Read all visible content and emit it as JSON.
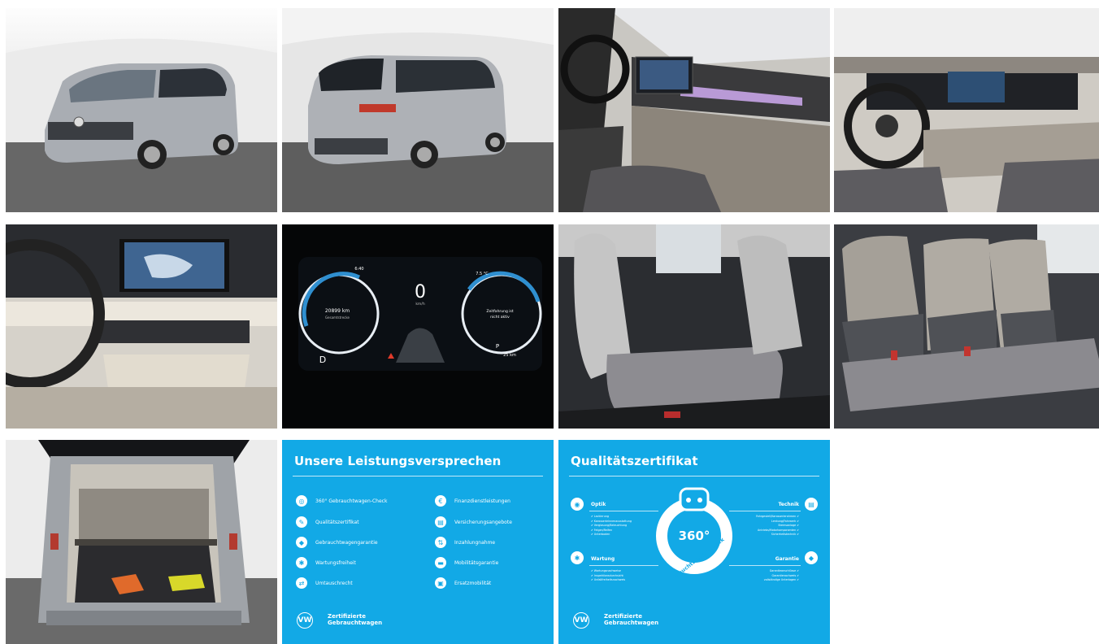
{
  "gallery": {
    "photos": [
      {
        "name": "van-front-left-photo"
      },
      {
        "name": "van-rear-left-photo"
      },
      {
        "name": "cockpit-passenger-side-photo"
      },
      {
        "name": "cockpit-driver-view-photo"
      },
      {
        "name": "infotainment-center-console-photo"
      },
      {
        "name": "digital-instrument-cluster-photo"
      },
      {
        "name": "middle-row-seats-photo"
      },
      {
        "name": "rear-bench-seats-photo"
      },
      {
        "name": "open-trunk-photo"
      }
    ],
    "cluster": {
      "speed": "0",
      "speed_unit": "km/h",
      "odometer": "20899 km",
      "odometer_label": "Gesamtstrecke",
      "gear": "D",
      "temperature": "7.5 °C",
      "right_msg_1": "Zeitfahrung ist",
      "right_msg_2": "nicht aktiv",
      "range": "25 km",
      "time": "6:40",
      "park": "P"
    }
  },
  "leistung_card": {
    "title": "Unsere Leistungsversprechen",
    "left_items": [
      "360° Gebrauchtwagen-Check",
      "Qualitätszertifikat",
      "Gebrauchtwagengarantie",
      "Wartungsfreiheit",
      "Umtauschrecht"
    ],
    "right_items": [
      "Finanzdienstleistungen",
      "Versicherungsangebote",
      "Inzahlungnahme",
      "Mobilitätsgarantie",
      "Ersatzmobilität"
    ],
    "footer_line1": "Zertifizierte",
    "footer_line2": "Gebrauchtwagen",
    "logo": "VW"
  },
  "quality_card": {
    "title": "Qualitätszertifikat",
    "badge_number": "360°",
    "badge_text": "Gebrauchtwagen-Check",
    "sections": {
      "optik": {
        "title": "Optik",
        "items": [
          "✔ Lackierung",
          "✔ Karosserieinnenausstattung",
          "✔ Verglasung/Beleuchtung",
          "✔ Felgen/Reifen",
          "✔ Unterboden"
        ]
      },
      "wartung": {
        "title": "Wartung",
        "items": [
          "✔ Wartungsnachweise",
          "✔ Inspektionsdurchsicht",
          "✔ Unfallfreiheitsnachweis"
        ]
      },
      "technik": {
        "title": "Technik",
        "items": [
          "Fahrgestell/Karosserierahmen ✔",
          "Lenkung/Fahrwerk ✔",
          "Bremsanlage ✔",
          "Antriebs/Motorkomponenten ✔",
          "Sicherheitstechnik ✔"
        ]
      },
      "garantie": {
        "title": "Garantie",
        "items": [
          "Garantieanschlüsse ✔",
          "Garantienachweis ✔",
          "vollständige Unterlagen ✔"
        ]
      }
    },
    "footer_line1": "Zertifizierte",
    "footer_line2": "Gebrauchtwagen",
    "logo": "VW"
  },
  "colors": {
    "card_blue": "#12a9e6",
    "white": "#ffffff",
    "van_silver": "#a9adb3"
  }
}
